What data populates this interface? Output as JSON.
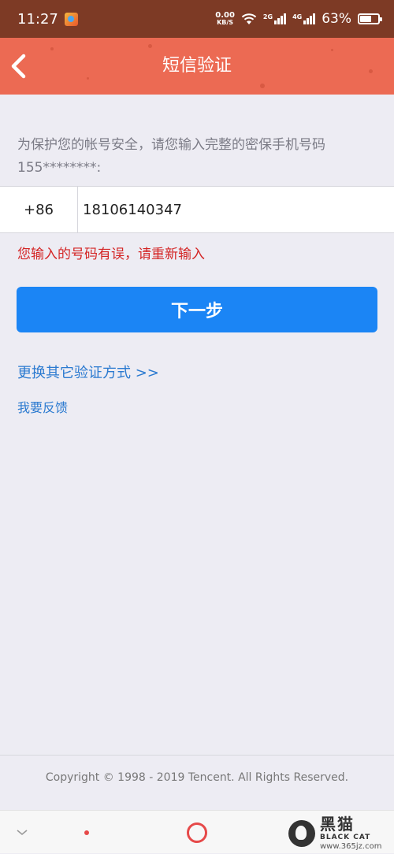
{
  "status_bar": {
    "time": "11:27",
    "net_speed_value": "0.00",
    "net_speed_unit": "KB/S",
    "signal_1_label": "2G",
    "signal_2_label": "4G",
    "battery_percent": "63%",
    "battery_level": 0.63
  },
  "header": {
    "title": "短信验证",
    "back_icon": "chevron-left-icon",
    "color": "#ec6a53"
  },
  "form": {
    "prompt": "为保护您的帐号安全，请您输入完整的密保手机号码155********:",
    "country_code": "+86",
    "phone_value": "18106140347",
    "error_message": "您输入的号码有误，请重新输入",
    "next_button": "下一步",
    "switch_method_link": "更换其它验证方式 >>",
    "feedback_link": "我要反馈"
  },
  "footer": {
    "copyright": "Copyright © 1998 - 2019 Tencent. All Rights Reserved."
  },
  "watermark": {
    "brand": "黑猫",
    "sub": "BLACK CAT",
    "url": "www.365jz.com"
  },
  "colors": {
    "primary_button": "#1b85f5",
    "error": "#d42525",
    "link": "#2b7ad0"
  }
}
